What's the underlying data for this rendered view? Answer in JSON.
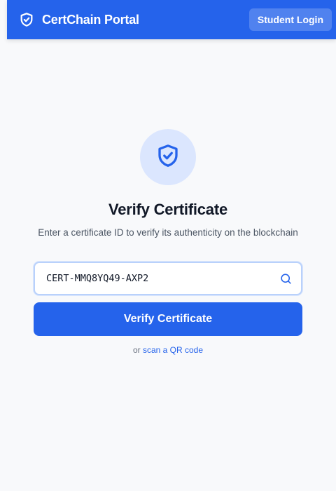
{
  "header": {
    "brand_icon": "shield-check-icon",
    "title": "CertChain Portal",
    "login_label": "Student Login"
  },
  "hero": {
    "icon": "shield-check-icon",
    "title": "Verify Certificate",
    "subtitle": "Enter a certificate ID to verify its authenticity on the blockchain"
  },
  "search": {
    "value": "CERT-MMQ8YQ49-AXP2",
    "icon": "search-icon"
  },
  "verify_button_label": "Verify Certificate",
  "alt": {
    "prefix": "or",
    "link_label": "scan a QR code"
  },
  "colors": {
    "primary": "#2563eb",
    "background": "#f8f9fb",
    "icon_circle": "#dbe6fe",
    "title_text": "#111827",
    "muted_text": "#4b5563"
  }
}
